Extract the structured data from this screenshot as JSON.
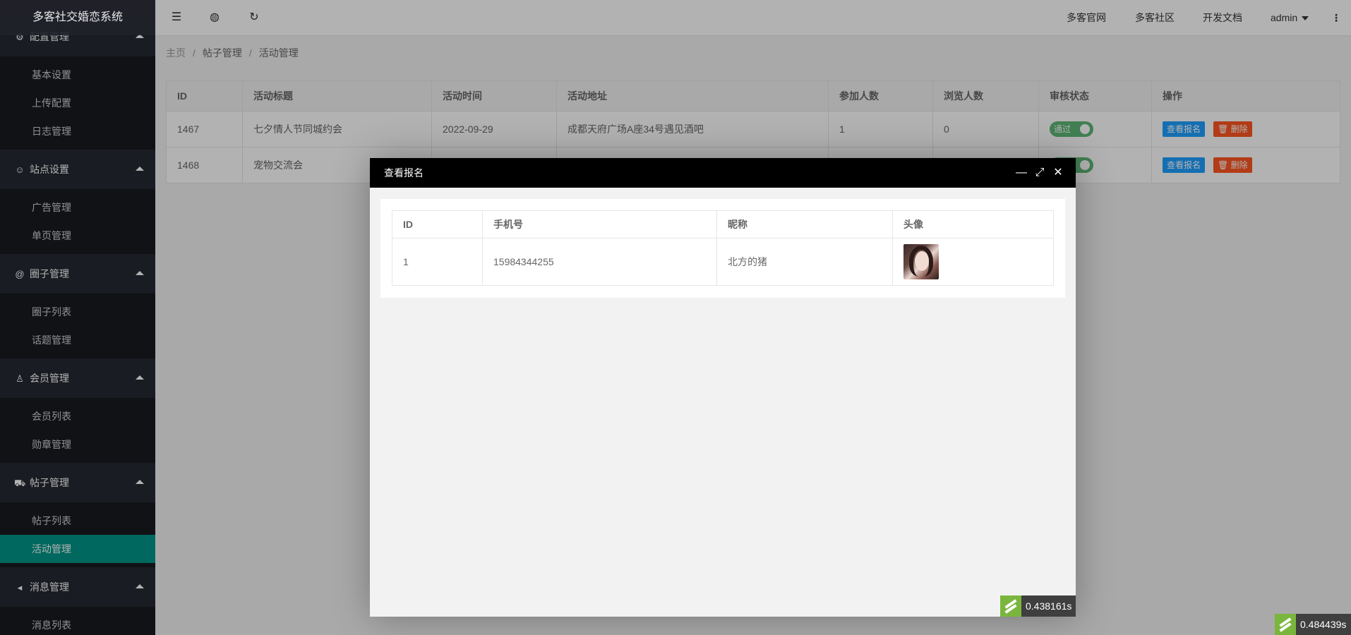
{
  "app": {
    "title": "多客社交婚恋系统"
  },
  "sidebar": {
    "groups": [
      {
        "title": "配置管理",
        "icon": "gear-icon",
        "items": [
          "基本设置",
          "上传配置",
          "日志管理"
        ]
      },
      {
        "title": "站点设置",
        "icon": "settings-icon",
        "items": [
          "广告管理",
          "单页管理"
        ]
      },
      {
        "title": "圈子管理",
        "icon": "at-icon",
        "items": [
          "圈子列表",
          "话题管理"
        ]
      },
      {
        "title": "会员管理",
        "icon": "user-icon",
        "items": [
          "会员列表",
          "勋章管理"
        ]
      },
      {
        "title": "帖子管理",
        "icon": "cart-icon",
        "items": [
          "帖子列表",
          "活动管理"
        ]
      },
      {
        "title": "消息管理",
        "icon": "speaker-icon",
        "items": [
          "消息列表"
        ]
      }
    ],
    "active_item": "活动管理"
  },
  "topbar": {
    "links": [
      "多客官网",
      "多客社区",
      "开发文档"
    ],
    "user": "admin"
  },
  "breadcrumb": {
    "home": "主页",
    "level1": "帖子管理",
    "level2": "活动管理"
  },
  "main_table": {
    "headers": [
      "ID",
      "活动标题",
      "活动时间",
      "活动地址",
      "参加人数",
      "浏览人数",
      "审核状态",
      "操作"
    ],
    "rows": [
      {
        "id": "1467",
        "title": "七夕情人节同城约会",
        "time": "2022-09-29",
        "address": "成都天府广场A座34号遇见酒吧",
        "joined": "1",
        "views": "0",
        "status": "通过"
      },
      {
        "id": "1468",
        "title": "宠物交流会",
        "time": "",
        "address": "",
        "joined": "",
        "views": "",
        "status": ""
      }
    ],
    "view_btn": "查看报名",
    "delete_btn": "删除"
  },
  "modal": {
    "title": "查看报名",
    "table": {
      "headers": [
        "ID",
        "手机号",
        "昵称",
        "头像"
      ],
      "rows": [
        {
          "id": "1",
          "phone": "15984344255",
          "nickname": "北方的猪"
        }
      ]
    },
    "timer": "0.438161s"
  },
  "page_timer": "0.484439s"
}
